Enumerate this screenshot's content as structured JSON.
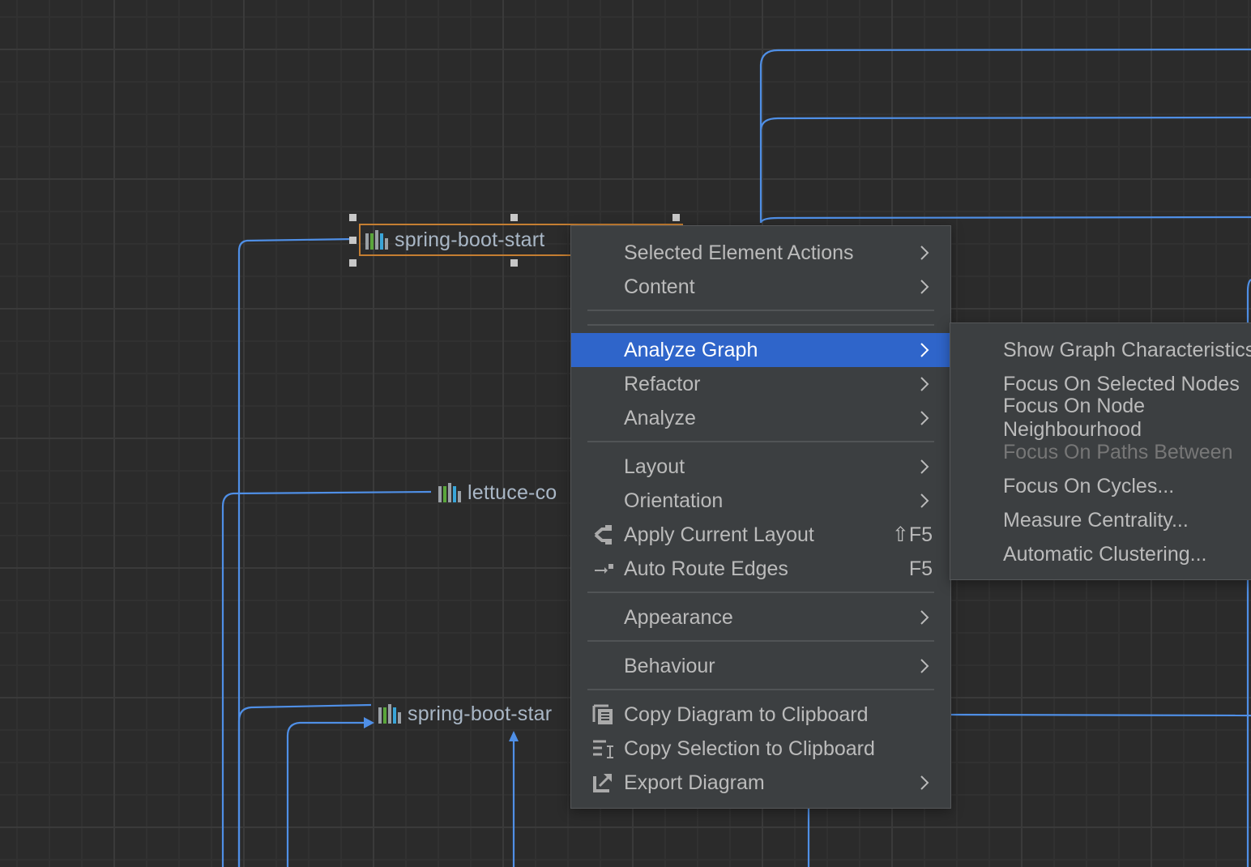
{
  "diagram": {
    "nodes": [
      {
        "label": "spring-boot-start",
        "selected": true
      },
      {
        "label": "lettuce-co",
        "selected": false
      },
      {
        "label": "spring-boot-star",
        "selected": false
      }
    ],
    "icon": "maven-library-icon",
    "colors": {
      "background": "#2b2b2b",
      "edge": "#4f8fe6",
      "selection": "#c57e32",
      "node_text": "#a9b7c6",
      "icon_bars": [
        "#9aa0a6",
        "#5aa63b",
        "#9aa0a6",
        "#3aa5d8",
        "#9aa0a6"
      ]
    }
  },
  "context_menu": {
    "items": [
      {
        "label": "Selected Element Actions",
        "submenu": true
      },
      {
        "label": "Content",
        "submenu": true
      },
      {
        "label": "Analyze Graph",
        "submenu": true,
        "highlighted": true
      },
      {
        "label": "Refactor",
        "submenu": true
      },
      {
        "label": "Analyze",
        "submenu": true
      },
      {
        "label": "Layout",
        "submenu": true
      },
      {
        "label": "Orientation",
        "submenu": true
      },
      {
        "label": "Apply Current Layout",
        "shortcut": "⇧F5",
        "icon": "apply-layout-icon"
      },
      {
        "label": "Auto Route Edges",
        "shortcut": "F5",
        "icon": "route-edges-icon"
      },
      {
        "label": "Appearance",
        "submenu": true
      },
      {
        "label": "Behaviour",
        "submenu": true
      },
      {
        "label": "Copy Diagram to Clipboard",
        "icon": "copy-diagram-icon"
      },
      {
        "label": "Copy Selection to Clipboard",
        "icon": "copy-selection-icon"
      },
      {
        "label": "Export Diagram",
        "submenu": true,
        "icon": "export-icon"
      }
    ],
    "colors": {
      "background": "#3c3f41",
      "highlight": "#2f65ca",
      "text": "#bbbbbb"
    }
  },
  "submenu": {
    "items": [
      {
        "label": "Show Graph Characteristics",
        "enabled": true
      },
      {
        "label": "Focus On Selected Nodes",
        "enabled": true
      },
      {
        "label": "Focus On Node Neighbourhood",
        "enabled": true
      },
      {
        "label": "Focus On Paths Between",
        "enabled": false
      },
      {
        "label": "Focus On Cycles...",
        "enabled": true
      },
      {
        "label": "Measure Centrality...",
        "enabled": true
      },
      {
        "label": "Automatic Clustering...",
        "enabled": true
      }
    ]
  }
}
